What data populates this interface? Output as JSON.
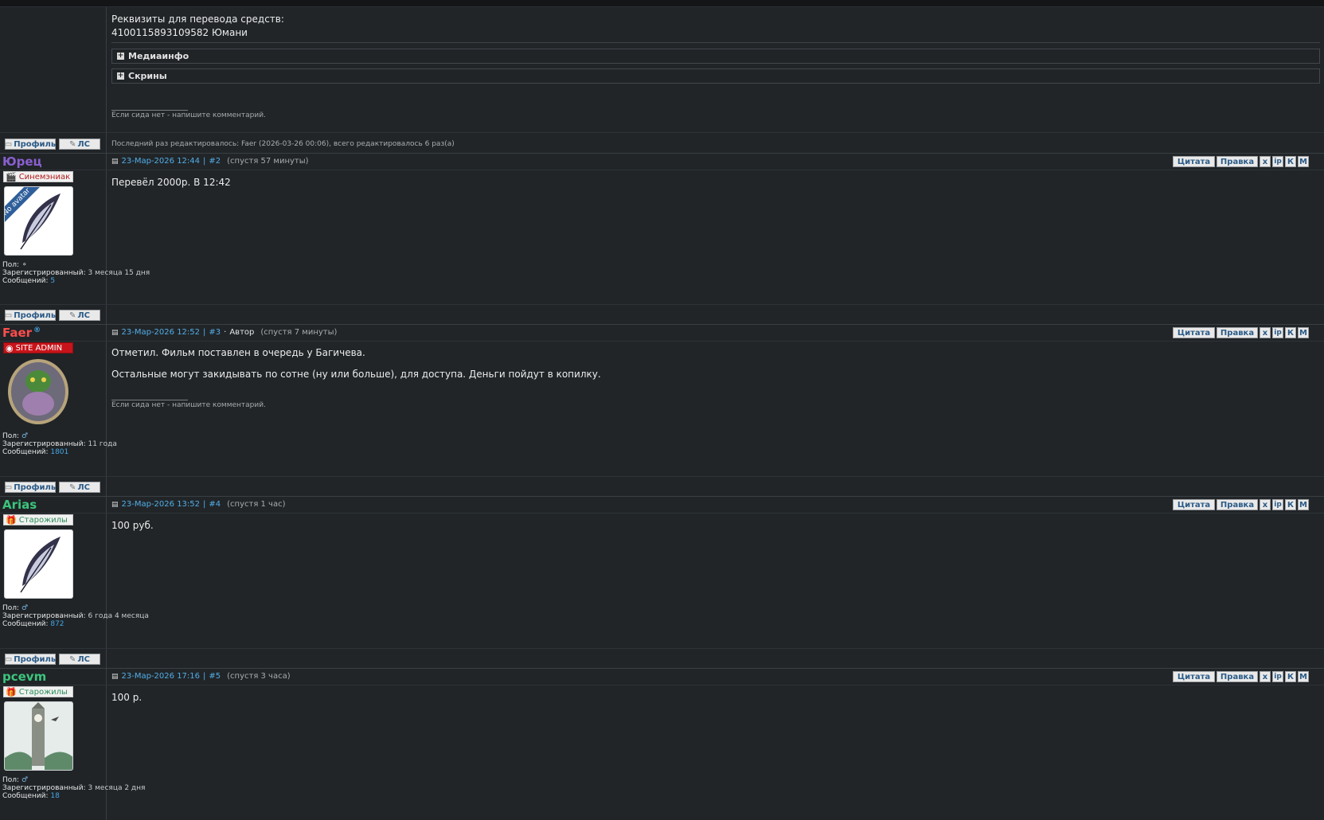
{
  "top": {
    "requisites_title": "Реквизиты для перевода средств:",
    "requisites_value": "410011589310958​2 Юмани",
    "spoiler_mediainfo": "Медиаинфо",
    "spoiler_screens": "Скрины",
    "signature": "Если сида нет - напишите комментарий.",
    "edit_note": "Последний раз редактировалось: Faer (2026-03-26 00:06), всего редактировалось 6 раз(а)"
  },
  "buttons": {
    "profile": "Профиль",
    "pm": "ЛС",
    "quote": "Цитата",
    "edit": "Правка",
    "delete": "x",
    "ip": "ip",
    "k": "К",
    "m": "М"
  },
  "labels": {
    "gender": "Пол:",
    "registered": "Зарегистрированный:",
    "messages": "Сообщений:",
    "author": "Автор",
    "no_avatar": "No avatar"
  },
  "posts": [
    {
      "username": "Юрец",
      "name_color": "#8a5fcf",
      "rank": "Синемэниак",
      "rank_icon": "clapperboard-icon",
      "gender_icon": "unknown-gender-icon",
      "registered": "3 месяца 15 дня",
      "messages": "5",
      "date": "23-Мар-2026 12:44",
      "num": "#2",
      "delay": "(спустя 57 минуты)",
      "body": "Перевёл 2000р. В 12:42"
    },
    {
      "username": "Faer",
      "name_color": "#ff4d4d",
      "rank": "SITE ADMIN",
      "rank_icon": "admin-icon",
      "gender_icon": "male-icon",
      "registered": "11 года",
      "messages": "1801",
      "date": "23-Мар-2026 12:52",
      "num": "#3",
      "author_mark": "Автор",
      "delay": "(спустя 7 минуты)",
      "body_line1": "Отметил. Фильм поставлен в очередь у Багичева.",
      "body_line2": "Остальные могут закидывать по сотне (ну или больше), для доступа. Деньги пойдут в копилку.",
      "signature": "Если сида нет - напишите комментарий."
    },
    {
      "username": "Arias",
      "name_color": "#3cc47c",
      "rank": "Старожилы",
      "rank_icon": "gift-icon",
      "gender_icon": "male-icon",
      "registered": "6 года 4 месяца",
      "messages": "872",
      "date": "23-Мар-2026 13:52",
      "num": "#4",
      "delay": "(спустя 1 час)",
      "body": "100 руб."
    },
    {
      "username": "pcevm",
      "name_color": "#3cc47c",
      "rank": "Старожилы",
      "rank_icon": "gift-icon",
      "gender_icon": "male-icon",
      "registered": "3 месяца 2 дня",
      "messages": "18",
      "date": "23-Мар-2026 17:16",
      "num": "#5",
      "delay": "(спустя 3 часа)",
      "body": "100 р."
    }
  ]
}
